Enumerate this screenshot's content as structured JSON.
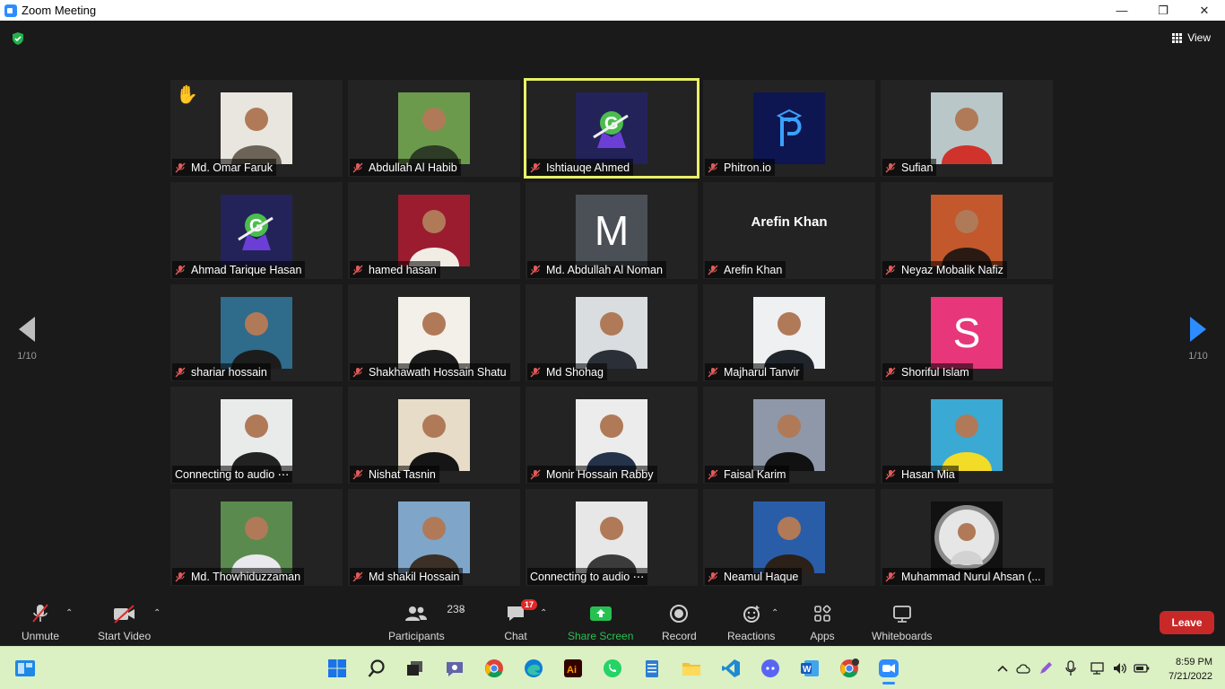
{
  "window": {
    "title": "Zoom Meeting",
    "minimize": "—",
    "maximize": "❐",
    "close": "✕"
  },
  "view": {
    "label": "View"
  },
  "pager": {
    "left": "1/10",
    "right": "1/10"
  },
  "participants": [
    {
      "name": "Md. Omar Faruk",
      "hand": "✋",
      "kind": "photo",
      "bg": "#e8e6df",
      "fg": "#6b6457"
    },
    {
      "name": "Abdullah Al Habib",
      "kind": "photo",
      "bg": "#6c9a4c",
      "fg": "#2d3b27"
    },
    {
      "name": "Ishtiauqe Ahmed",
      "kind": "logo-g",
      "active": true
    },
    {
      "name": "Phitron.io",
      "kind": "logo-p"
    },
    {
      "name": "Sufian",
      "kind": "photo",
      "bg": "#b9c7c9",
      "fg": "#d0332c"
    },
    {
      "name": "Ahmad Tarique Hasan",
      "kind": "logo-g"
    },
    {
      "name": "hamed hasan",
      "kind": "photo",
      "bg": "#9b1c2f",
      "fg": "#f1ece4"
    },
    {
      "name": "Md. Abdullah Al Noman",
      "kind": "initial",
      "initial": "M",
      "bg": "#4a5056"
    },
    {
      "name": "Arefin Khan",
      "kind": "text",
      "display": "Arefin Khan"
    },
    {
      "name": "Neyaz Mobalik Nafiz",
      "kind": "photo",
      "bg": "#c2582c",
      "fg": "#2a1a14"
    },
    {
      "name": "shariar hossain",
      "kind": "photo",
      "bg": "#2f6b8a",
      "fg": "#1c1c1c"
    },
    {
      "name": "Shakhawath Hossain Shatu",
      "kind": "photo",
      "bg": "#f3efe9",
      "fg": "#1c1c1c"
    },
    {
      "name": "Md Shohag",
      "kind": "photo",
      "bg": "#d9dde0",
      "fg": "#2a2f38"
    },
    {
      "name": "Majharul Tanvir",
      "kind": "photo",
      "bg": "#eef0f1",
      "fg": "#20252c"
    },
    {
      "name": "Shoriful Islam",
      "kind": "initial",
      "initial": "S",
      "bg": "#e8367a"
    },
    {
      "name": "Connecting to audio ⋯",
      "kind": "photo",
      "bg": "#e9eaea",
      "fg": "#222",
      "connecting": true
    },
    {
      "name": "Nishat Tasnin",
      "kind": "photo",
      "bg": "#e6dcc8",
      "fg": "#151515"
    },
    {
      "name": "Monir Hossain Rabby",
      "kind": "photo",
      "bg": "#ececec",
      "fg": "#24324a"
    },
    {
      "name": "Faisal Karim",
      "kind": "photo",
      "bg": "#8f98a8",
      "fg": "#111"
    },
    {
      "name": "Hasan Mia",
      "kind": "photo",
      "bg": "#3aa9d4",
      "fg": "#f2dc27"
    },
    {
      "name": "Md. Thowhiduzzaman",
      "kind": "photo",
      "bg": "#5a8a4e",
      "fg": "#e8e8ee"
    },
    {
      "name": "Md shakil Hossain",
      "kind": "photo",
      "bg": "#7fa6c9",
      "fg": "#3b3026"
    },
    {
      "name": "Connecting to audio ⋯",
      "kind": "photo",
      "bg": "#e7e7e7",
      "fg": "#3b3b3b",
      "connecting": true
    },
    {
      "name": "Neamul Haque",
      "kind": "photo",
      "bg": "#2a5da8",
      "fg": "#2b2119"
    },
    {
      "name": "Muhammad Nurul Ahsan (...",
      "kind": "photo",
      "bg": "#111111",
      "fg": "#d2d2d2",
      "round": true
    }
  ],
  "toolbar": {
    "unmute": "Unmute",
    "start_video": "Start Video",
    "participants": "Participants",
    "participants_count": "238",
    "chat": "Chat",
    "chat_badge": "17",
    "share_screen": "Share Screen",
    "record": "Record",
    "reactions": "Reactions",
    "apps": "Apps",
    "whiteboards": "Whiteboards",
    "leave": "Leave"
  },
  "taskbar": {
    "time": "8:59 PM",
    "date": "7/21/2022",
    "apps": [
      "windows-start",
      "search",
      "task-view",
      "teams-chat",
      "chrome",
      "edge",
      "illustrator",
      "whatsapp",
      "notepad",
      "file-explorer",
      "vscode",
      "discord",
      "word",
      "chrome-profile",
      "zoom"
    ]
  },
  "colors": {
    "accent": "#2d8cff",
    "active_speaker": "#e8f066",
    "leave": "#c82828",
    "share": "#27c152",
    "taskbar_bg": "#dbf0c3"
  }
}
